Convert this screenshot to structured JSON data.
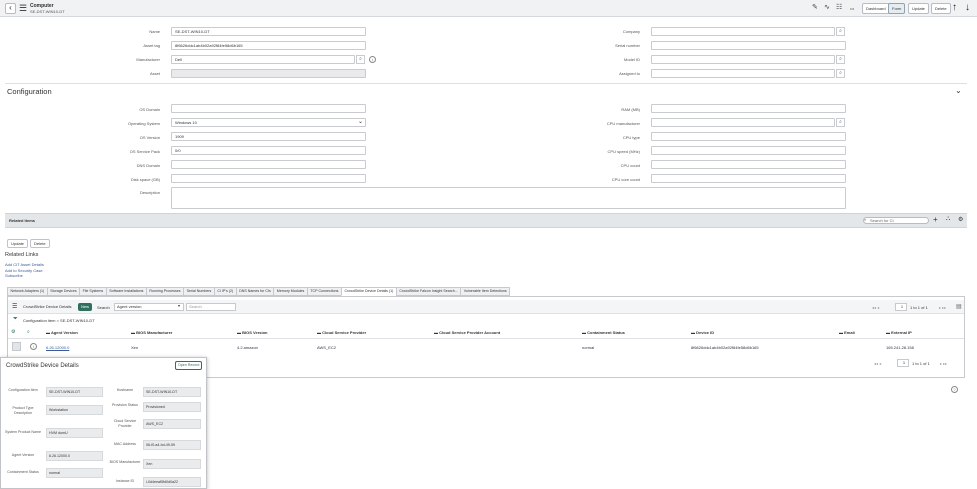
{
  "header": {
    "title": "Computer",
    "subtitle": "SE-DST-WIN10-DT",
    "icons": [
      "paperclip-icon",
      "activity-icon",
      "settings-sliders-icon",
      "more-icon"
    ],
    "more_label": "•••",
    "buttons": {
      "dashboard": "Dashboard",
      "form": "Form",
      "update": "Update",
      "delete": "Delete"
    }
  },
  "form": {
    "left": [
      {
        "label": "Name",
        "value": "SE-DST-WIN10-DT"
      },
      {
        "label": "Asset tag",
        "value": "8f6626ddc1ab4b02a92f84fe58d6b165"
      },
      {
        "label": "Manufacturer",
        "value": "Dell"
      },
      {
        "label": "Asset",
        "value": ""
      }
    ],
    "right": [
      {
        "label": "Company",
        "value": ""
      },
      {
        "label": "Serial number",
        "value": ""
      },
      {
        "label": "Model ID",
        "value": ""
      },
      {
        "label": "Assigned to",
        "value": ""
      }
    ]
  },
  "configuration": {
    "title": "Configuration",
    "left": [
      {
        "label": "OS Domain",
        "value": ""
      },
      {
        "label": "Operating System",
        "value": "Windows 10"
      },
      {
        "label": "OS Version",
        "value": "1909"
      },
      {
        "label": "OS Service Pack",
        "value": "0/0"
      },
      {
        "label": "DNS Domain",
        "value": ""
      },
      {
        "label": "Disk space (GB)",
        "value": ""
      },
      {
        "label": "Description",
        "value": ""
      }
    ],
    "right": [
      {
        "label": "RAM (MB)",
        "value": ""
      },
      {
        "label": "CPU manufacturer",
        "value": ""
      },
      {
        "label": "CPU type",
        "value": ""
      },
      {
        "label": "CPU speed (MHz)",
        "value": ""
      },
      {
        "label": "CPU count",
        "value": ""
      },
      {
        "label": "CPU core count",
        "value": ""
      }
    ]
  },
  "related_items": {
    "title": "Related Items",
    "search_placeholder": "Search for CI"
  },
  "actions": {
    "update": "Update",
    "delete": "Delete"
  },
  "related_links": {
    "title": "Related Links",
    "links": [
      "Add CIT Asset Details",
      "Add to Security Case",
      "Subscribe"
    ]
  },
  "tabs": [
    "Network Adapters (1)",
    "Storage Devices",
    "File Systems",
    "Software Installations",
    "Running Processes",
    "Serial Numbers",
    "CI IP's (2)",
    "DNS Names for CIs",
    "Memory Modules",
    "TCP Connections",
    "CrowdStrike Device Details (1)",
    "CrowdStrike Falcon Insight Search...",
    "Vulnerable Item Detections"
  ],
  "related_list": {
    "title": "CrowdStrike Device Details",
    "new_label": "New",
    "search_label": "Search",
    "search_field": "Agent version",
    "search_placeholder": "Search",
    "breadcrumb": "Configuration item = SE-DST-WIN10-DT",
    "pagination_top": "1  to 1 of 1",
    "pagination_bottom": "1  to 1 of 1",
    "columns": [
      "Agent Version",
      "BIOS Manufacturer",
      "BIOS Version",
      "Cloud Service Provider",
      "Cloud Service Provider Account",
      "Containment Status",
      "Device ID",
      "Email",
      "External IP"
    ],
    "rows": [
      [
        "6.26.12000.0",
        "Xen",
        "4.2.amazon",
        "AWS_EC2",
        "",
        "normal",
        "8f6626ddc1ab4b02a92f84fe58d6b165",
        "",
        "165.241.28.158"
      ]
    ]
  },
  "popup": {
    "title": "CrowdStrike Device Details",
    "open_record": "Open Record",
    "left": [
      {
        "label": "Configuration Item",
        "value": "SE-DST-WIN10-DT"
      },
      {
        "label": "Product Type Description",
        "value": "Workstation"
      },
      {
        "label": "System Product Name",
        "value": "HVM domU"
      },
      {
        "label": "Agent Version",
        "value": "6.26.12000.0"
      },
      {
        "label": "Containment Status",
        "value": "normal"
      }
    ],
    "right": [
      {
        "label": "Hostname",
        "value": "SE-DST-WIN10-DT"
      },
      {
        "label": "Provision Status",
        "value": "Provisioned"
      },
      {
        "label": "Cloud Service Provider",
        "value": "AWS_EC2"
      },
      {
        "label": "MAC Address",
        "value": "06-f0-a4-bd-49-59"
      },
      {
        "label": "BIOS Manufacturer",
        "value": "Xen"
      },
      {
        "label": "Instance ID",
        "value": "i-0d4eeaf5fd0d0a22"
      }
    ]
  }
}
